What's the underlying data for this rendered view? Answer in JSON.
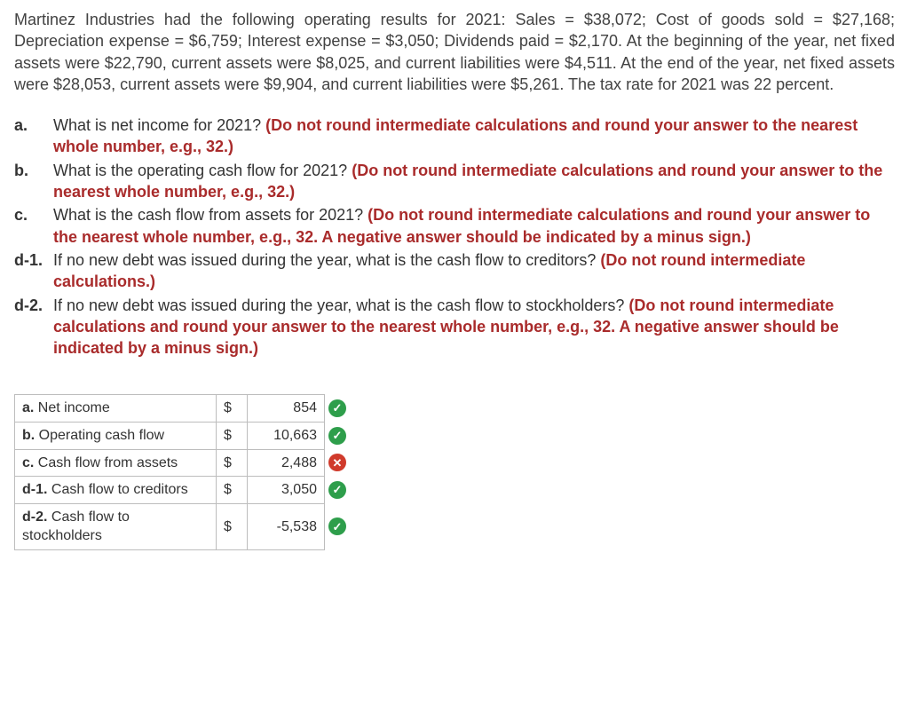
{
  "intro": "Martinez Industries had the following operating results for 2021: Sales = $38,072; Cost of goods sold = $27,168; Depreciation expense = $6,759; Interest expense = $3,050; Dividends paid = $2,170. At the beginning of the year, net fixed assets were $22,790, current assets were $8,025, and current liabilities were $4,511. At the end of the year, net fixed assets were $28,053, current assets were $9,904, and current liabilities were $5,261. The tax rate for 2021 was 22 percent.",
  "questions": {
    "a": {
      "label": "a.",
      "text": "What is net income for 2021? ",
      "hint": "(Do not round intermediate calculations and round your answer to the nearest whole number, e.g., 32.)"
    },
    "b": {
      "label": "b.",
      "text": "What is the operating cash flow for 2021? ",
      "hint": "(Do not round intermediate calculations and round your answer to the nearest whole number, e.g., 32.)"
    },
    "c": {
      "label": "c.",
      "text": "What is the cash flow from assets for 2021? ",
      "hint": "(Do not round intermediate calculations and round your answer to the nearest whole number, e.g., 32. A negative answer should be indicated by a minus sign.)"
    },
    "d1": {
      "label": "d-1.",
      "text": "If no new debt was issued during the year, what is the cash flow to creditors? ",
      "hint": "(Do not round intermediate calculations.)"
    },
    "d2": {
      "label": "d-2.",
      "text": "If no new debt was issued during the year, what is the cash flow to stockholders? ",
      "hint": "(Do not round intermediate calculations and round your answer to the nearest whole number, e.g., 32. A negative answer should be indicated by a minus sign.)"
    }
  },
  "answers": {
    "a": {
      "key": "a.",
      "desc": "Net income",
      "cur": "$",
      "val": "854",
      "status": "ok"
    },
    "b": {
      "key": "b.",
      "desc": "Operating cash flow",
      "cur": "$",
      "val": "10,663",
      "status": "ok"
    },
    "c": {
      "key": "c.",
      "desc": "Cash flow from assets",
      "cur": "$",
      "val": "2,488",
      "status": "bad"
    },
    "d1": {
      "key": "d-1.",
      "desc": "Cash flow to creditors",
      "cur": "$",
      "val": "3,050",
      "status": "ok"
    },
    "d2": {
      "key": "d-2.",
      "desc": "Cash flow to stockholders",
      "cur": "$",
      "val": "-5,538",
      "status": "ok"
    }
  },
  "glyphs": {
    "ok": "✓",
    "bad": "✕"
  }
}
